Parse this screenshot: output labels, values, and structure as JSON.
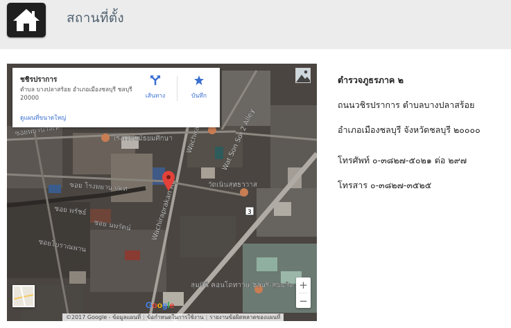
{
  "header": {
    "title": "สถานที่ตั้ง",
    "home_icon": "home-icon"
  },
  "map": {
    "infocard": {
      "place": "ชชิรปราการ",
      "address": "ตำบล บางปลาสร้อย อำเภอเมืองชลบุรี ชลบุรี 20000",
      "directions_label": "เส้นทาง",
      "save_label": "บันทึก",
      "larger_map_link": "ดูแผนที่ขนาดใหญ่"
    },
    "labels": {
      "school": "โรงเรียนมัธยมศึกษา",
      "soi1": "ซอยพยาบาลเท",
      "soi2": "ซอย โรงพยาบาลเท",
      "wat": "วัดเนินสุทธาวาส",
      "road1": "Wachiraprakan Rd",
      "road2": "Wachiraprakan Rd",
      "soi3": "ซอย พรัชธ์",
      "soi4": "ซอย นพรัตน์",
      "soi5": "ซอยโบราณพาน",
      "mall": "ลุมพินี คอนโดทาวน์ ชลบุรี-สุขุมวิท",
      "soi6": "Wat Son Soi 2 Alley",
      "route": "3"
    },
    "zoom_in": "+",
    "zoom_out": "−",
    "logo": "Google",
    "attribution": {
      "copyright": "©2017 Google - ข้อมูลแผนที่",
      "terms": "ข้อกำหนดในการใช้งาน",
      "report": "รายงานข้อผิดพลาดของแผนที่"
    }
  },
  "contact": {
    "name": "ตำรวจภูธรภาค ๒",
    "street": "ถนนวชิรปราการ ตำบลบางปลาสร้อย",
    "district": "อำเภอเมืองชลบุรี จังหวัดชลบุรี ๒๐๐๐๐",
    "phone": "โทรศัพท์ ๐-๓๘๒๗-๕๐๒๑ ต่อ ๒๙๗",
    "fax": "โทรสาร ๐-๓๘๒๗-๓๕๒๕"
  }
}
